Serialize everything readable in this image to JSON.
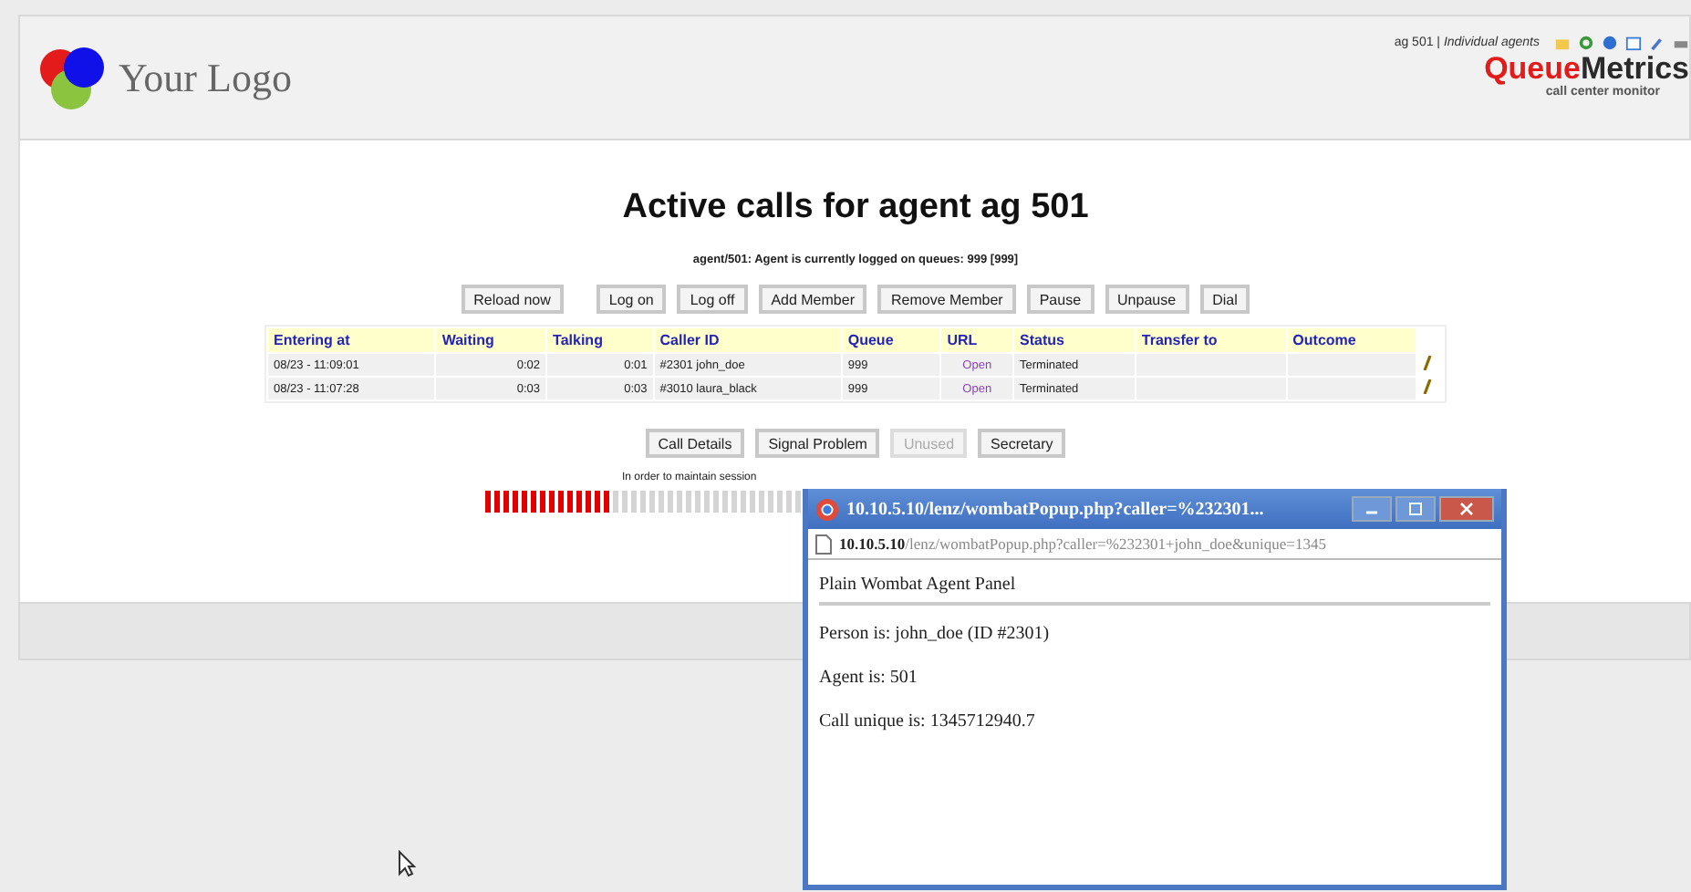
{
  "header": {
    "logo_text": "Your Logo",
    "user_info": "ag 501 | *Individual agents*",
    "brand": {
      "first": "Queue",
      "second": "Metrics",
      "tagline": "call center monitor"
    }
  },
  "title": "Active calls for agent ag 501",
  "subtitle": "agent/501: Agent is currently logged on queues: 999 [999]",
  "top_buttons": [
    {
      "label": "Reload now",
      "disabled": false
    },
    {
      "label": "Log on",
      "disabled": false
    },
    {
      "label": "Log off",
      "disabled": false
    },
    {
      "label": "Add Member",
      "disabled": false
    },
    {
      "label": "Remove Member",
      "disabled": false
    },
    {
      "label": "Pause",
      "disabled": false
    },
    {
      "label": "Unpause",
      "disabled": false
    },
    {
      "label": "Dial",
      "disabled": false
    }
  ],
  "table": {
    "columns": [
      "Entering at",
      "Waiting",
      "Talking",
      "Caller ID",
      "Queue",
      "URL",
      "Status",
      "Transfer to",
      "Outcome"
    ],
    "rows": [
      {
        "entering_at": "08/23 - 11:09:01",
        "waiting": "0:02",
        "talking": "0:01",
        "caller_id": "#2301 john_doe",
        "queue": "999",
        "url": "Open",
        "status": "Terminated"
      },
      {
        "entering_at": "08/23 - 11:07:28",
        "waiting": "0:03",
        "talking": "0:03",
        "caller_id": "#3010 laura_black",
        "queue": "999",
        "url": "Open",
        "status": "Terminated"
      }
    ]
  },
  "bottom_buttons": [
    {
      "label": "Call Details",
      "disabled": false
    },
    {
      "label": "Signal Problem",
      "disabled": false
    },
    {
      "label": "Unused",
      "disabled": true
    },
    {
      "label": "Secretary",
      "disabled": false
    }
  ],
  "session_note": "In order to maintain session",
  "session_bar": {
    "level": 0.4
  },
  "popup": {
    "title": "10.10.5.10/lenz/wombatPopup.php?caller=%232301...",
    "address_host": "10.10.5.10",
    "address_path": "/lenz/wombatPopup.php?caller=%232301+john_doe&unique=1345",
    "heading": "Plain Wombat Agent Panel",
    "lines": [
      "Person is: john_doe (ID #2301)",
      "Agent is: 501",
      "Call unique is: 1345712940.7"
    ]
  }
}
